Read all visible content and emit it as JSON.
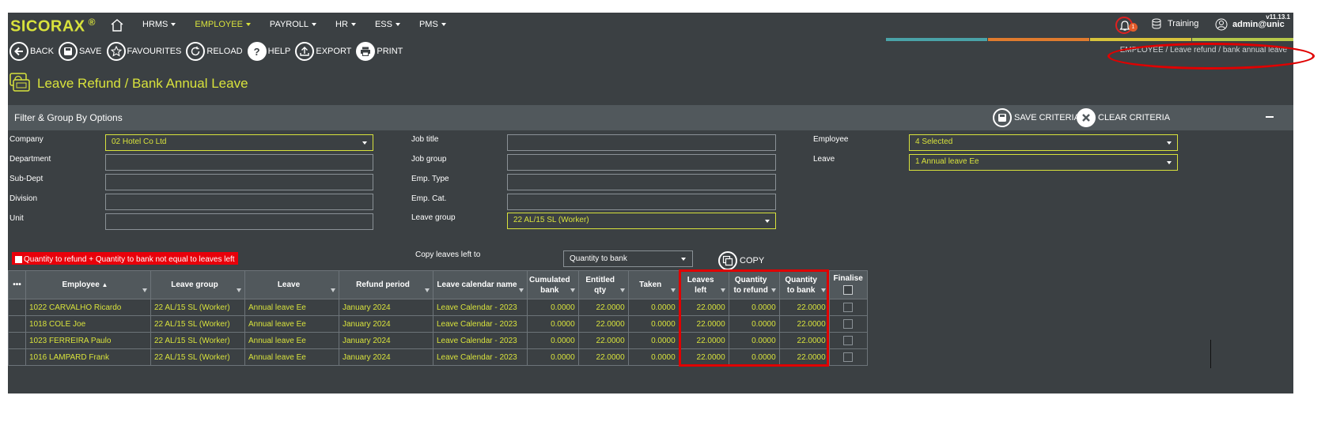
{
  "app": {
    "logo": "SICORAX",
    "logo_mark": "®",
    "version": "v11.13.1",
    "menu": [
      {
        "label": "HRMS",
        "active": false
      },
      {
        "label": "EMPLOYEE",
        "active": true
      },
      {
        "label": "PAYROLL",
        "active": false
      },
      {
        "label": "HR",
        "active": false
      },
      {
        "label": "ESS",
        "active": false
      },
      {
        "label": "PMS",
        "active": false
      }
    ],
    "notification_count": "1",
    "training_label": "Training",
    "user_label": "admin@unic",
    "accent_color": "#d8e23c",
    "color_bars": [
      "#4aa3a8",
      "#e07b2e",
      "#d8c43c",
      "#b7c94a"
    ]
  },
  "toolbar": {
    "back": "BACK",
    "save": "SAVE",
    "favourites": "FAVOURITES",
    "reload": "RELOAD",
    "help": "HELP",
    "export": "EXPORT",
    "print": "PRINT"
  },
  "breadcrumb": {
    "root": "EMPLOYEE",
    "separator": "/",
    "current": "Leave refund / bank annual leave"
  },
  "page": {
    "title": "Leave Refund / Bank Annual Leave"
  },
  "filter": {
    "heading": "Filter & Group By Options",
    "save_criteria": "SAVE CRITERIA",
    "clear_criteria": "CLEAR CRITERIA",
    "labels": {
      "company": "Company",
      "department": "Department",
      "sub_dept": "Sub-Dept",
      "division": "Division",
      "unit": "Unit",
      "job_title": "Job title",
      "job_group": "Job group",
      "emp_type": "Emp. Type",
      "emp_cat": "Emp. Cat.",
      "leave_group": "Leave group",
      "employee": "Employee",
      "leave": "Leave",
      "copy_to": "Copy leaves left to"
    },
    "values": {
      "company": "02 Hotel Co Ltd",
      "leave_group": "22 AL/15 SL (Worker)",
      "employee": "4 Selected",
      "leave": "1 Annual leave Ee",
      "copy_to": "Quantity to bank"
    },
    "warning": "Quantity to refund + Quantity to bank not equal to leaves left",
    "copy_button": "COPY"
  },
  "grid": {
    "menu_glyph": "•••",
    "sort_glyph": "▲",
    "columns": [
      {
        "l1": "Employee",
        "l2": ""
      },
      {
        "l1": "Leave group",
        "l2": ""
      },
      {
        "l1": "Leave",
        "l2": ""
      },
      {
        "l1": "Refund period",
        "l2": ""
      },
      {
        "l1": "Leave calendar name",
        "l2": ""
      },
      {
        "l1": "Cumulated",
        "l2": "bank"
      },
      {
        "l1": "Entitled",
        "l2": "qty"
      },
      {
        "l1": "Taken",
        "l2": ""
      },
      {
        "l1": "Leaves",
        "l2": "left"
      },
      {
        "l1": "Quantity",
        "l2": "to refund"
      },
      {
        "l1": "Quantity",
        "l2": "to bank"
      },
      {
        "l1": "Finalise",
        "l2": ""
      }
    ],
    "rows": [
      [
        "1022 CARVALHO Ricardo",
        "22 AL/15 SL (Worker)",
        "Annual leave Ee",
        "January 2024",
        "Leave Calendar - 2023",
        "0.0000",
        "22.0000",
        "0.0000",
        "22.0000",
        "0.0000",
        "22.0000"
      ],
      [
        "1018 COLE Joe",
        "22 AL/15 SL (Worker)",
        "Annual leave Ee",
        "January 2024",
        "Leave Calendar - 2023",
        "0.0000",
        "22.0000",
        "0.0000",
        "22.0000",
        "0.0000",
        "22.0000"
      ],
      [
        "1023 FERREIRA Paulo",
        "22 AL/15 SL (Worker)",
        "Annual leave Ee",
        "January 2024",
        "Leave Calendar - 2023",
        "0.0000",
        "22.0000",
        "0.0000",
        "22.0000",
        "0.0000",
        "22.0000"
      ],
      [
        "1016 LAMPARD Frank",
        "22 AL/15 SL (Worker)",
        "Annual leave Ee",
        "January 2024",
        "Leave Calendar - 2023",
        "0.0000",
        "22.0000",
        "0.0000",
        "22.0000",
        "0.0000",
        "22.0000"
      ]
    ]
  }
}
